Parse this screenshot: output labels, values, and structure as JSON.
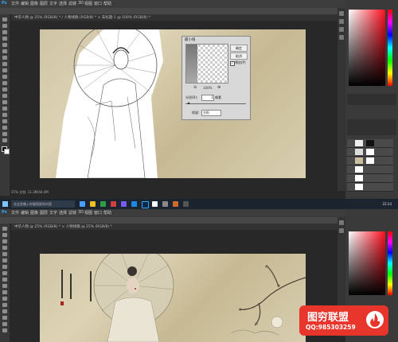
{
  "top_window": {
    "title_tab": "中华人物 @ 25% (RGB/8) * / 人物线稿 (RGB/8) * × 未标题-1 @ 100% (RGB/8) *",
    "menu": [
      "文件",
      "编辑",
      "图像",
      "图层",
      "文字",
      "选择",
      "滤镜",
      "3D",
      "视图",
      "窗口",
      "帮助"
    ],
    "status": "25%  文档: 11.3M/44.0M",
    "dialog": {
      "title": "最小值",
      "ok_label": "确定",
      "cancel_label": "取消",
      "preview_label": "预览(P)",
      "zoom": "100%",
      "radius_label": "半径(R):",
      "radius_value": "1",
      "unit": "像素",
      "keep_label": "保留:",
      "keep_value": "方形"
    }
  },
  "taskbar": {
    "search_placeholder": "在这里输入你要搜索的内容",
    "time": "22:24",
    "colors": [
      "#4a9eff",
      "#f0c020",
      "#2ea043",
      "#d04040",
      "#7a5af8",
      "#1e88e5",
      "#ffffff"
    ]
  },
  "bottom_window": {
    "title_tab": "中华人物 @ 25% (RGB/8) * × 人物线稿 @ 25% (RGB/8) *",
    "menu": [
      "文件",
      "编辑",
      "图像",
      "图层",
      "文字",
      "选择",
      "滤镜",
      "3D",
      "视图",
      "窗口",
      "帮助"
    ]
  },
  "watermark": {
    "brand": "图穷联盟",
    "contact": "QQ:985303259"
  },
  "colors": {
    "accent_red": "#e8352b",
    "panel": "#3a3a3a",
    "canvas_bg": "#282828"
  }
}
